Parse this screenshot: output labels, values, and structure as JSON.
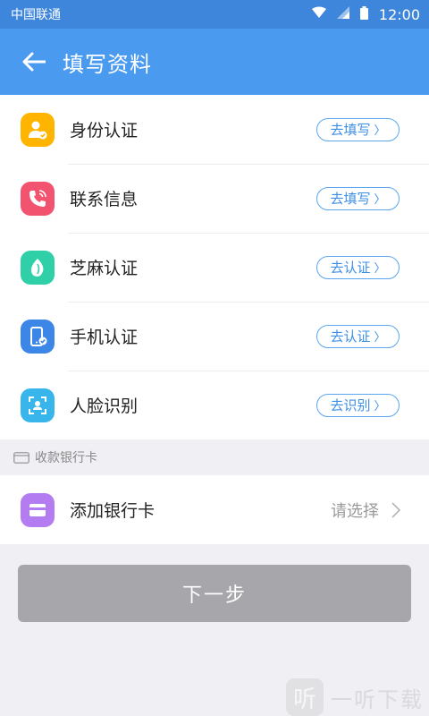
{
  "status_bar": {
    "carrier": "中国联通",
    "time": "12:00"
  },
  "app_bar": {
    "title": "填写资料"
  },
  "verification_items": [
    {
      "icon": "id-card-user-icon",
      "label": "身份认证",
      "action": "去填写",
      "color": "#ffb400"
    },
    {
      "icon": "phone-contact-icon",
      "label": "联系信息",
      "action": "去填写",
      "color": "#f2546f"
    },
    {
      "icon": "sesame-leaf-icon",
      "label": "芝麻认证",
      "action": "去认证",
      "color": "#2fd0a8"
    },
    {
      "icon": "mobile-verify-icon",
      "label": "手机认证",
      "action": "去认证",
      "color": "#3b86e6"
    },
    {
      "icon": "face-scan-icon",
      "label": "人脸识别",
      "action": "去识别",
      "color": "#38b6ec"
    }
  ],
  "bank_section": {
    "header": "收款银行卡",
    "item": {
      "icon": "bank-card-icon",
      "label": "添加银行卡",
      "value": "请选择",
      "color": "#b37cf0"
    }
  },
  "next_button": {
    "label": "下一步"
  },
  "watermark": {
    "glyph": "听",
    "text": "一听下载"
  }
}
